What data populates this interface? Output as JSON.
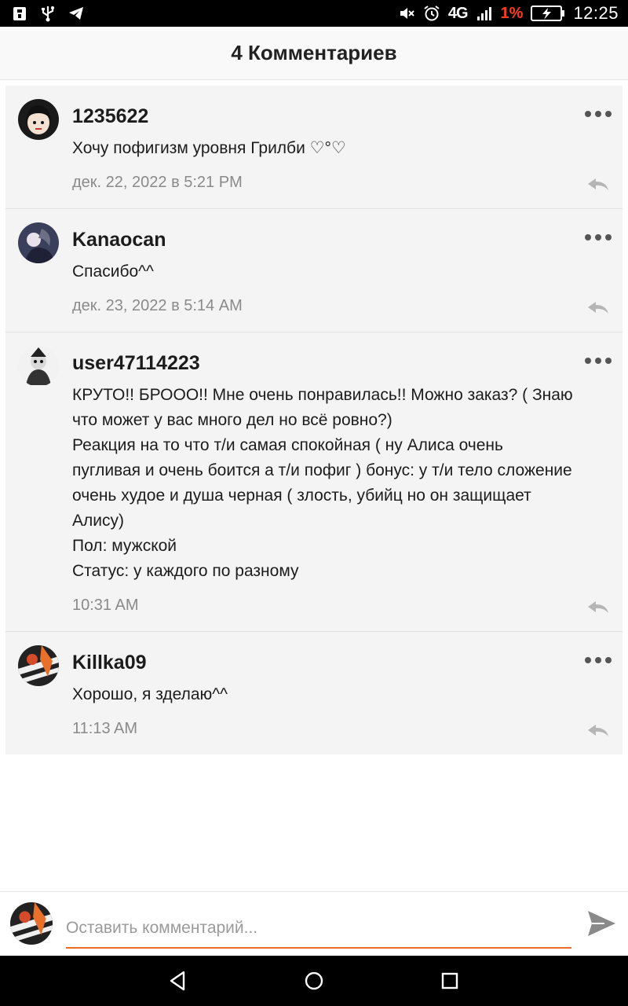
{
  "statusbar": {
    "network": "4G",
    "battery_percent": "1%",
    "time": "12:25",
    "icons": [
      "lock-icon",
      "usb-icon",
      "telegram-icon",
      "mute-icon",
      "alarm-icon",
      "signal-icon",
      "battery-charging-icon"
    ]
  },
  "header": {
    "title": "4 Комментариев"
  },
  "comments": [
    {
      "username": "1235622",
      "text": "Хочу пофигизм уровня Грилби ♡°♡",
      "time": "дек. 22, 2022 в 5:21 PM"
    },
    {
      "username": "Kanaocan",
      "text": "Спасибо^^",
      "time": "дек. 23, 2022 в 5:14 AM"
    },
    {
      "username": "user47114223",
      "text": "КРУТО!! БРООО!! Мне очень понравилась!! Можно заказ? ( Знаю что может у вас много дел но всё ровно?)\nРеакция на то что т/и самая спокойная ( ну Алиса очень пугливая и очень боится а т/и пофиг ) бонус: у т/и тело сложение очень худое и душа черная ( злость, убийц но он защищает Алису)\nПол: мужской\nСтатус: у каждого по разному",
      "time": "10:31 AM"
    },
    {
      "username": "Killka09",
      "text": "Хорошо, я зделаю^^",
      "time": "11:13 AM"
    }
  ],
  "composer": {
    "placeholder": "Оставить комментарий..."
  },
  "colors": {
    "accent": "#f06a23",
    "battery_low": "#ff3b1f"
  }
}
